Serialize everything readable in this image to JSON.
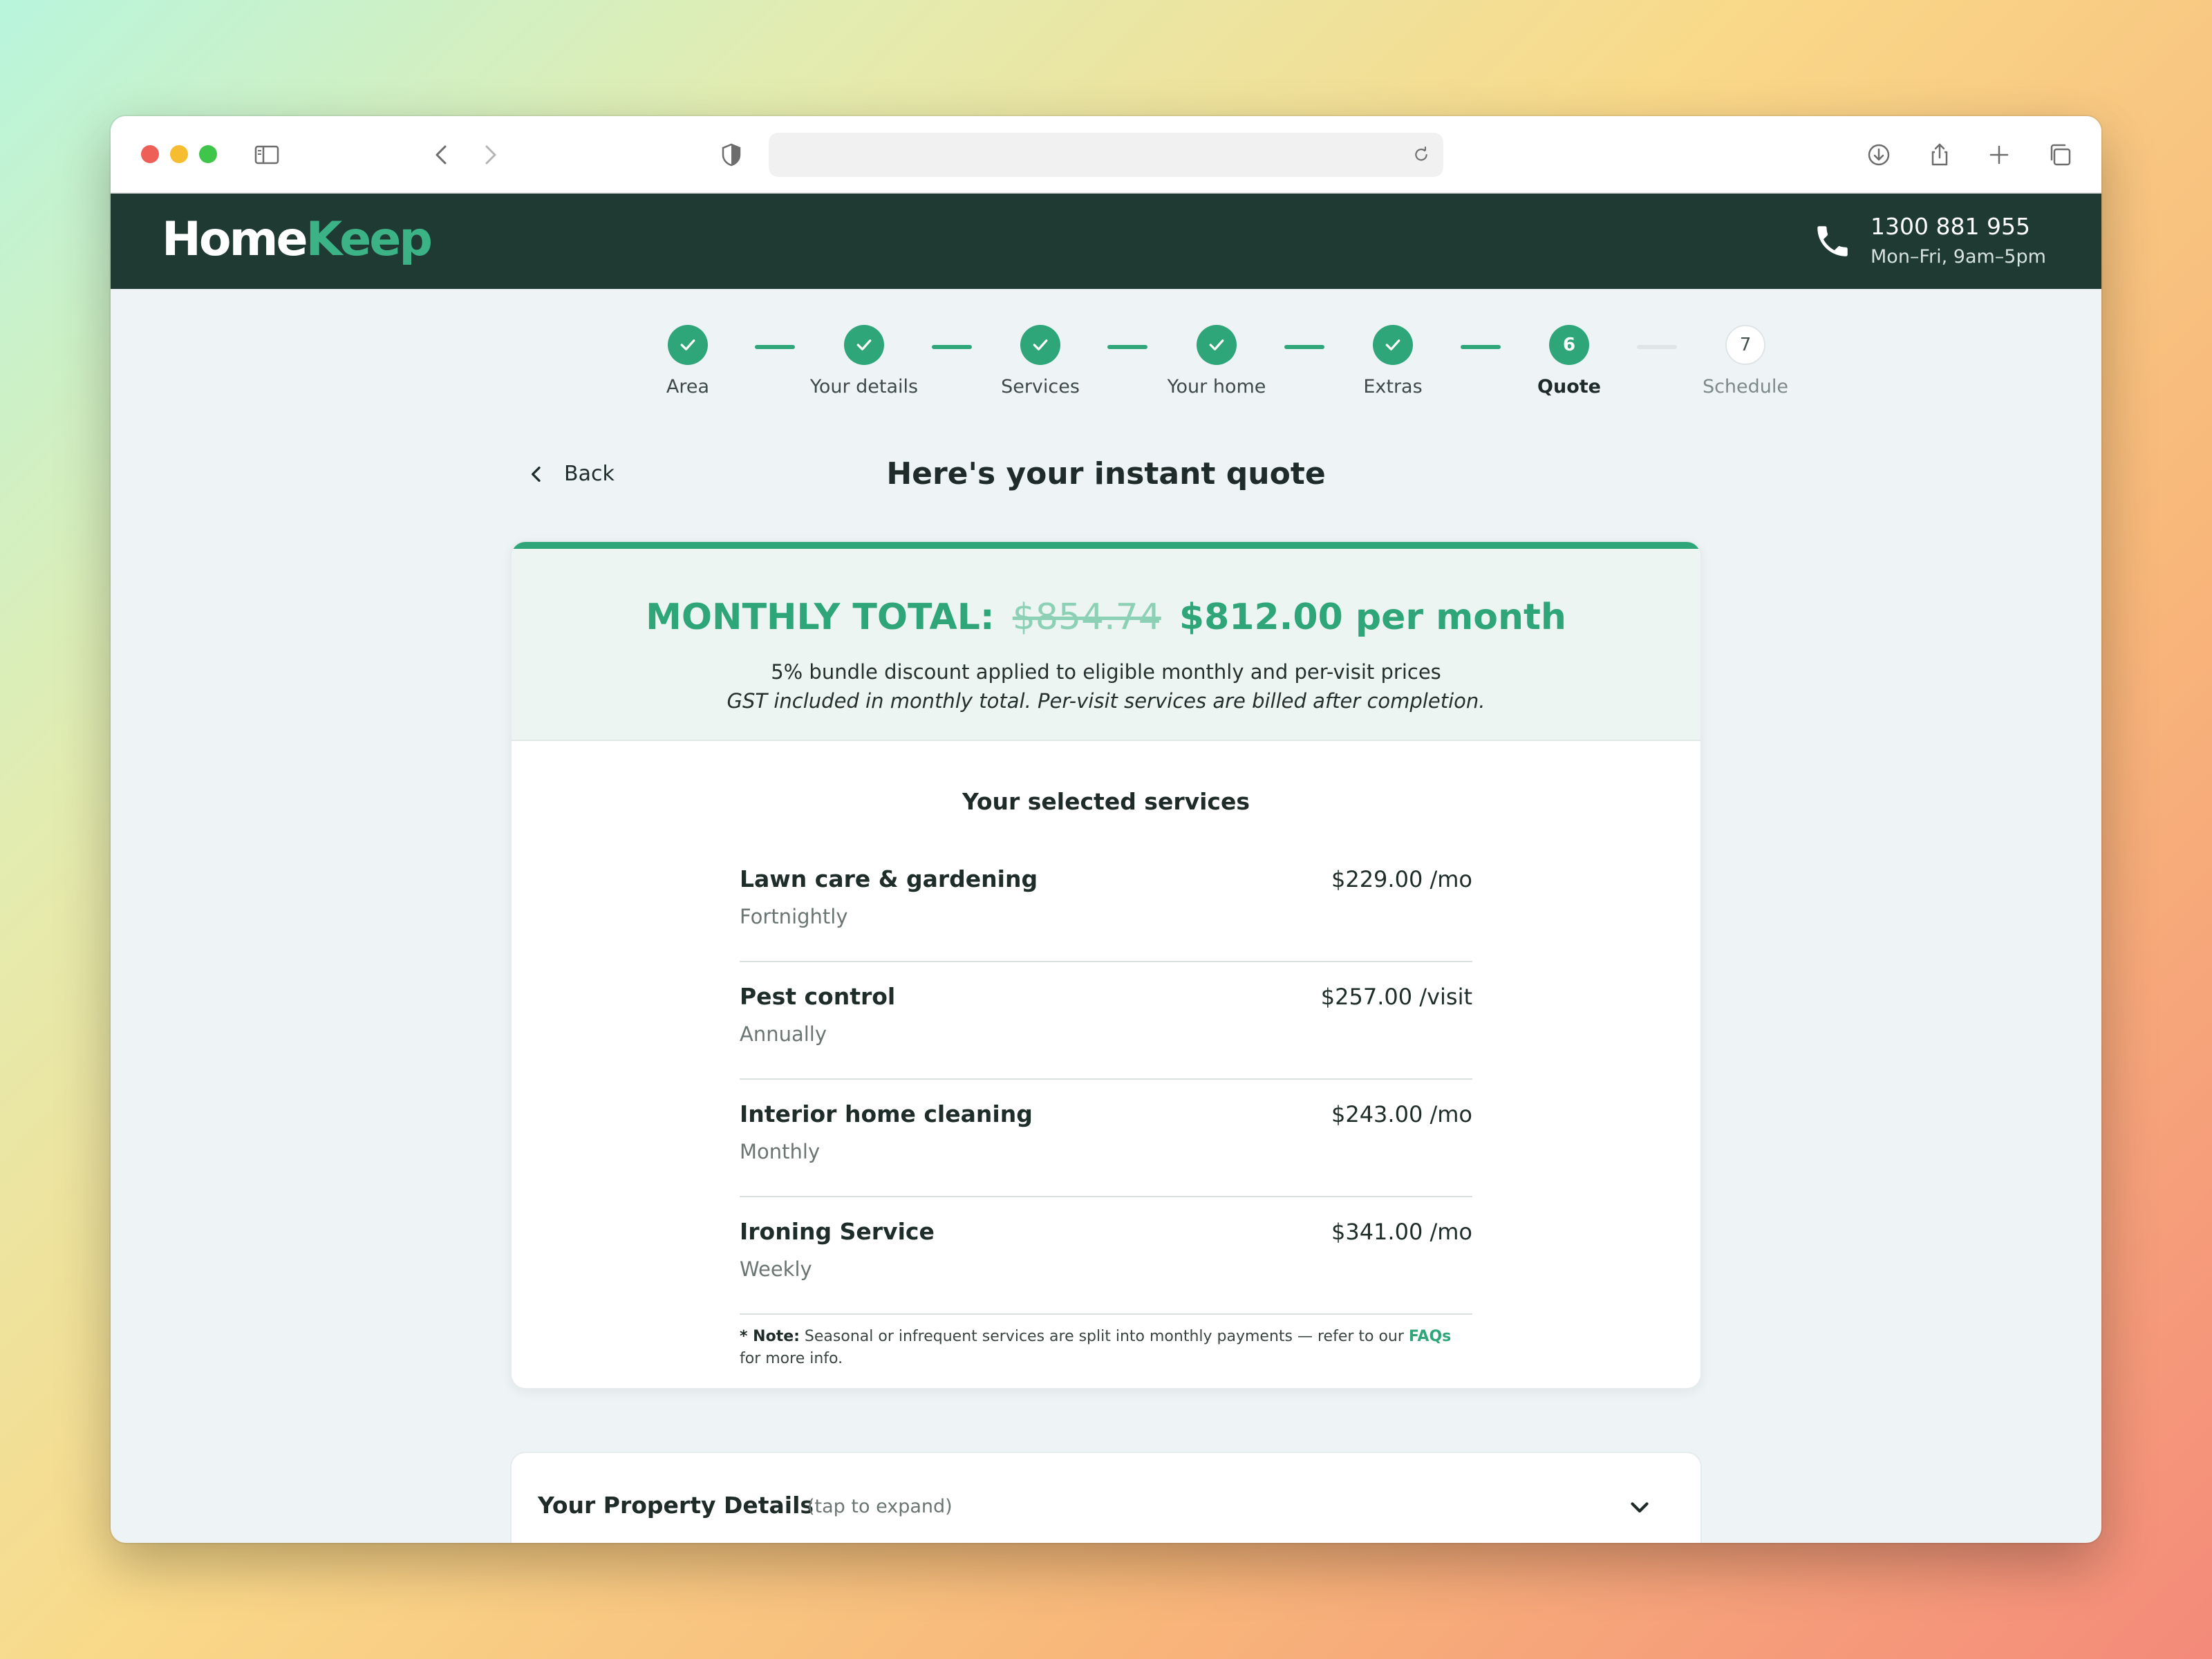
{
  "brand": {
    "logo_part1": "Home",
    "logo_part2": "Keep",
    "colors": {
      "header_bg": "#1f3a33",
      "accent": "#2fa57a",
      "logo_accent": "#3cb386"
    }
  },
  "contact": {
    "phone": "1300 881 955",
    "hours": "Mon–Fri, 9am–5pm",
    "icon": "phone-icon"
  },
  "stepper": {
    "steps": [
      {
        "label": "Area",
        "status": "complete"
      },
      {
        "label": "Your details",
        "status": "complete"
      },
      {
        "label": "Services",
        "status": "complete"
      },
      {
        "label": "Your home",
        "status": "complete"
      },
      {
        "label": "Extras",
        "status": "complete"
      },
      {
        "label": "Quote",
        "status": "current",
        "number": "6"
      },
      {
        "label": "Schedule",
        "status": "upcoming",
        "number": "7"
      }
    ]
  },
  "nav": {
    "back_label": "Back"
  },
  "page": {
    "title": "Here's your instant quote"
  },
  "quote": {
    "total_label": "MONTHLY TOTAL:",
    "old_price": "$854.74",
    "new_price": "$812.00 per month",
    "discount_text": "5% bundle discount applied to eligible monthly and per-visit prices",
    "gst_text": "GST included in monthly total. Per-visit services are billed after completion."
  },
  "services": {
    "title": "Your selected services",
    "items": [
      {
        "name": "Lawn care & gardening",
        "frequency": "Fortnightly",
        "price": "$229.00",
        "unit": "/mo"
      },
      {
        "name": "Pest control",
        "frequency": "Annually",
        "price": "$257.00",
        "unit": "/visit"
      },
      {
        "name": "Interior home cleaning",
        "frequency": "Monthly",
        "price": "$243.00",
        "unit": "/mo"
      },
      {
        "name": "Ironing Service",
        "frequency": "Weekly",
        "price": "$341.00",
        "unit": "/mo"
      }
    ],
    "note_label": "* Note:",
    "note_text": " Seasonal or infrequent services are split into monthly payments — refer to our ",
    "note_link": "FAQs",
    "note_end": " for more info."
  },
  "property": {
    "title": "Your Property Details",
    "hint": "(tap to expand)"
  }
}
